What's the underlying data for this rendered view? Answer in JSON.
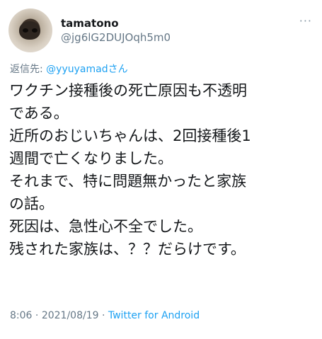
{
  "tweet": {
    "author": {
      "display_name": "tamatono",
      "handle": "@jg6lG2DUJOqh5m0",
      "avatar_icon": "dog-nose-avatar"
    },
    "more_icon": "more-options-icon",
    "more_glyph": "···",
    "reply_to": {
      "prefix": "返信先: ",
      "mention": "@yyuyamadさん"
    },
    "body_lines": [
      "ワクチン接種後の死亡原因も不透明",
      "である。",
      "近所のおじいちゃんは、2回接種後1",
      "週間で亡くなりました。",
      "それまで、特に問題無かったと家族",
      "の話。",
      "死因は、急性心不全でした。",
      "残された家族は、？？だらけです。"
    ],
    "meta": {
      "time": "8:06",
      "separator1": " · ",
      "date": "2021/08/19",
      "separator2": " · ",
      "source": "Twitter for Android"
    },
    "colors": {
      "accent": "#1da1f2",
      "secondary_text": "#657786",
      "primary_text": "#14171a"
    }
  }
}
